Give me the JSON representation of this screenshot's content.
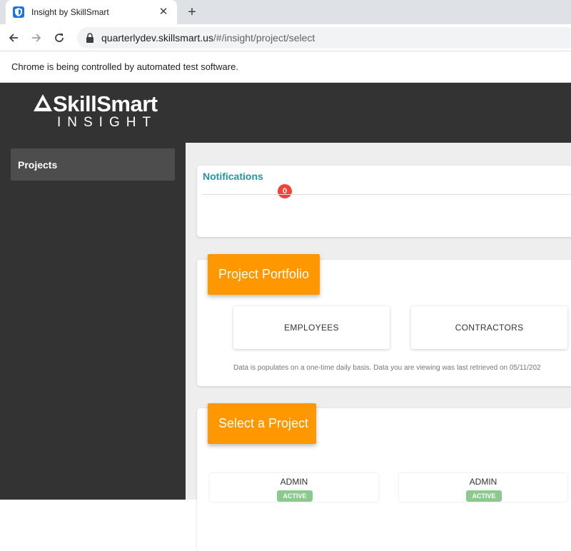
{
  "browser": {
    "tab_title": "Insight by SkillSmart",
    "tab_close": "✕",
    "new_tab": "+",
    "url_host": "quarterlydev.skillsmart.us",
    "url_path": "/#/insight/project/select",
    "infobar_text": "Chrome is being controlled by automated test software."
  },
  "app": {
    "logo_word": "SkillSmart",
    "logo_sub": "INSIGHT"
  },
  "sidebar": {
    "items": [
      {
        "label": "Projects"
      }
    ]
  },
  "notifications": {
    "title": "Notifications",
    "count": "0"
  },
  "portfolio": {
    "header": "Project Portfolio",
    "buttons": [
      "EMPLOYEES",
      "CONTRACTORS"
    ],
    "disclaimer": "Data is populates on a one-time daily basis. Data you are viewing was last retrieved on 05/11/202"
  },
  "select_project": {
    "header": "Select a Project",
    "projects": [
      {
        "role": "ADMIN",
        "status": "ACTIVE"
      },
      {
        "role": "ADMIN",
        "status": "ACTIVE"
      }
    ]
  },
  "colors": {
    "accent_orange": "#ff9800",
    "header_dark": "#333333",
    "notification_teal": "#2196a6",
    "badge_red": "#f44336",
    "status_green": "#8bc98f"
  },
  "icons": [
    "shield-favicon-icon",
    "close-icon",
    "plus-icon",
    "back-arrow-icon",
    "forward-arrow-icon",
    "reload-icon",
    "lock-icon",
    "skillsmart-logo-icon"
  ]
}
